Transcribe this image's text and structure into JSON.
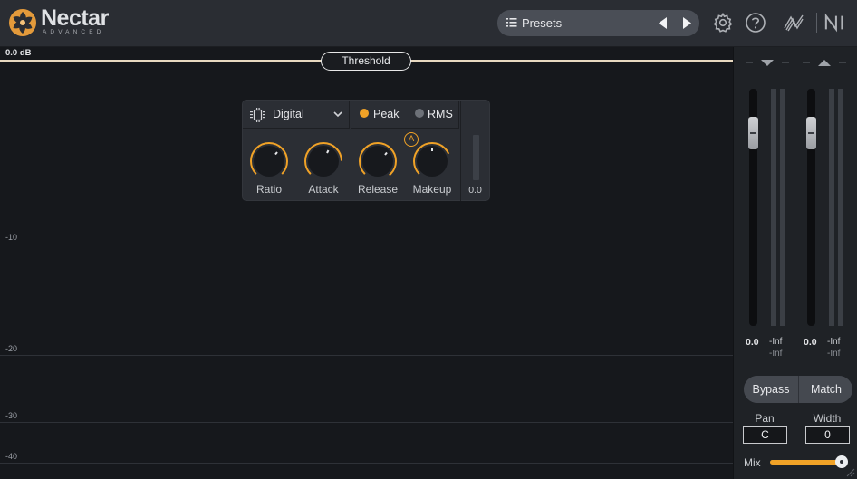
{
  "header": {
    "brand": "Nectar",
    "brand_sub": "ADVANCED",
    "presets_label": "Presets",
    "icons": [
      "list-icon",
      "previous-preset-icon",
      "next-preset-icon",
      "settings-gear-icon",
      "help-icon",
      "signal-flow-icon",
      "ni-logo-icon"
    ]
  },
  "graph": {
    "top_db": "0.0 dB",
    "threshold_label": "Threshold",
    "grid_labels": [
      "-10",
      "-20",
      "-30",
      "-40"
    ]
  },
  "compressor": {
    "mode": "Digital",
    "detection": {
      "peak_label": "Peak",
      "rms_label": "RMS",
      "selected": "Peak"
    },
    "knobs": [
      {
        "label": "Ratio"
      },
      {
        "label": "Attack"
      },
      {
        "label": "Release"
      },
      {
        "label": "Makeup"
      }
    ],
    "auto_badge": "A",
    "gain_reduction_value": "0.0"
  },
  "sidebar": {
    "input_value": "0.0",
    "input_meter_top": "-Inf",
    "input_meter_bottom": "-Inf",
    "output_value": "0.0",
    "output_meter_top": "-Inf",
    "output_meter_bottom": "-Inf",
    "bypass_label": "Bypass",
    "match_label": "Match",
    "pan_label": "Pan",
    "pan_value": "C",
    "width_label": "Width",
    "width_value": "0",
    "mix_label": "Mix",
    "mix_level": 1.0
  },
  "colors": {
    "accent": "#f0a227",
    "background": "#16181c",
    "header": "#2a2d33",
    "panel": "#2b2e34"
  }
}
